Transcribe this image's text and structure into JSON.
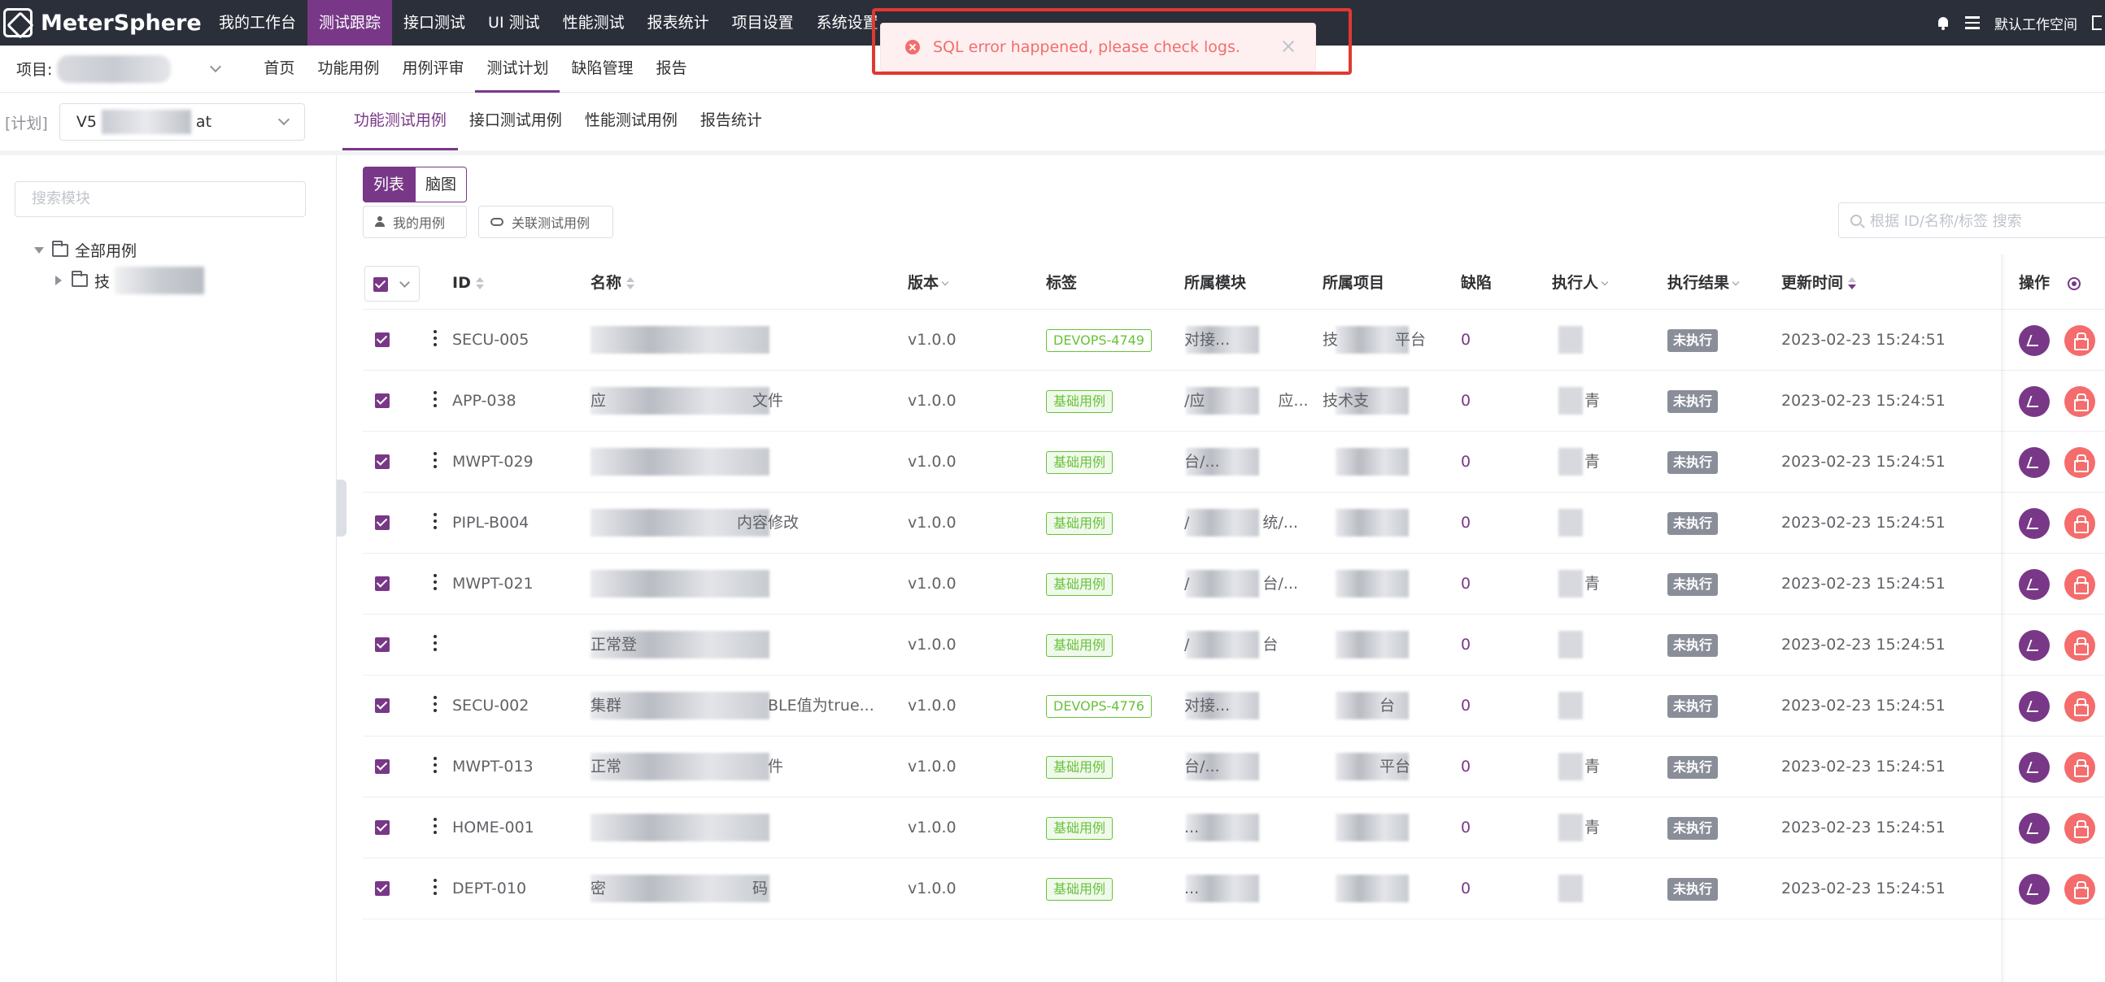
{
  "app": {
    "logo_text": "MeterSphere"
  },
  "topnav": [
    "我的工作台",
    "测试跟踪",
    "接口测试",
    "UI 测试",
    "性能测试",
    "报表统计",
    "项目设置",
    "系统设置"
  ],
  "topnav_active": 1,
  "topright": {
    "workspace": "默认工作空间"
  },
  "subbar": {
    "project_label": "项目:",
    "items": [
      "首页",
      "功能用例",
      "用例评审",
      "测试计划",
      "缺陷管理",
      "报告"
    ],
    "active": 3
  },
  "planbar": {
    "label": "[计划]",
    "plan_prefix": "V5",
    "plan_suffix": "at",
    "tabs": [
      "功能测试用例",
      "接口测试用例",
      "性能测试用例",
      "报告统计"
    ],
    "active": 0
  },
  "tree": {
    "search_placeholder": "搜索模块",
    "root": "全部用例",
    "child_prefix": "技"
  },
  "toolbar": {
    "list_label": "列表",
    "mind_label": "脑图",
    "my_cases": "我的用例",
    "link_cases": "关联测试用例",
    "search_placeholder": "根据 ID/名称/标签 搜索"
  },
  "columns": {
    "id": "ID",
    "name": "名称",
    "version": "版本",
    "tags": "标签",
    "module": "所属模块",
    "project": "所属项目",
    "bugs": "缺陷",
    "executor": "执行人",
    "result": "执行结果",
    "updated": "更新时间",
    "ops": "操作"
  },
  "rows": [
    {
      "id": "SECU-005",
      "name": "",
      "version": "v1.0.0",
      "tag": "DEVOPS-4749",
      "module": "对接...",
      "project": "技",
      "project2": "平台",
      "bugs": "0",
      "executor": "",
      "result": "未执行",
      "updated": "2023-02-23 15:24:51"
    },
    {
      "id": "APP-038",
      "name": "应",
      "name2": "文件",
      "version": "v1.0.0",
      "tag": "基础用例",
      "module": "/应",
      "module2": "应...",
      "project": "技术支",
      "bugs": "0",
      "executor": "青",
      "result": "未执行",
      "updated": "2023-02-23 15:24:51"
    },
    {
      "id": "MWPT-029",
      "name": "",
      "version": "v1.0.0",
      "tag": "基础用例",
      "module": "台/...",
      "project": "",
      "bugs": "0",
      "executor": "青",
      "result": "未执行",
      "updated": "2023-02-23 15:24:51"
    },
    {
      "id": "PIPL-B004",
      "name": "",
      "name2": "内容修改",
      "version": "v1.0.0",
      "tag": "基础用例",
      "module": "/",
      "module2": "统/...",
      "project": "",
      "bugs": "0",
      "executor": "",
      "result": "未执行",
      "updated": "2023-02-23 15:24:51"
    },
    {
      "id": "MWPT-021",
      "name": "",
      "version": "v1.0.0",
      "tag": "基础用例",
      "module": "/",
      "module2": "台/...",
      "project": "",
      "bugs": "0",
      "executor": "青",
      "result": "未执行",
      "updated": "2023-02-23 15:24:51"
    },
    {
      "id": "",
      "name": "正常登",
      "version": "v1.0.0",
      "tag": "基础用例",
      "module": "/",
      "module2": "台",
      "project": "",
      "bugs": "0",
      "executor": "",
      "result": "未执行",
      "updated": "2023-02-23 15:24:51"
    },
    {
      "id": "SECU-002",
      "name": "集群",
      "name2": "BLE值为true...",
      "version": "v1.0.0",
      "tag": "DEVOPS-4776",
      "module": "对接...",
      "project": "",
      "project2": "台",
      "bugs": "0",
      "executor": "",
      "result": "未执行",
      "updated": "2023-02-23 15:24:51"
    },
    {
      "id": "MWPT-013",
      "name": "正常",
      "name2": "件",
      "version": "v1.0.0",
      "tag": "基础用例",
      "module": "台/...",
      "project": "",
      "project2": "平台",
      "bugs": "0",
      "executor": "青",
      "result": "未执行",
      "updated": "2023-02-23 15:24:51"
    },
    {
      "id": "HOME-001",
      "name": "",
      "version": "v1.0.0",
      "tag": "基础用例",
      "module": "...",
      "project": "",
      "bugs": "0",
      "executor": "青",
      "result": "未执行",
      "updated": "2023-02-23 15:24:51"
    },
    {
      "id": "DEPT-010",
      "name": "密",
      "name2": "码",
      "version": "v1.0.0",
      "tag": "基础用例",
      "module": "...",
      "project": "",
      "bugs": "0",
      "executor": "",
      "result": "未执行",
      "updated": "2023-02-23 15:24:51"
    }
  ],
  "toast": {
    "message": "SQL error happened, please check logs."
  },
  "colors": {
    "brand": "#783887",
    "topbar": "#2b2f3a",
    "tag_green": "#67c23a",
    "tag_devops": "#67c23a",
    "error": "#f56c6c",
    "delete": "#f56c6c"
  }
}
